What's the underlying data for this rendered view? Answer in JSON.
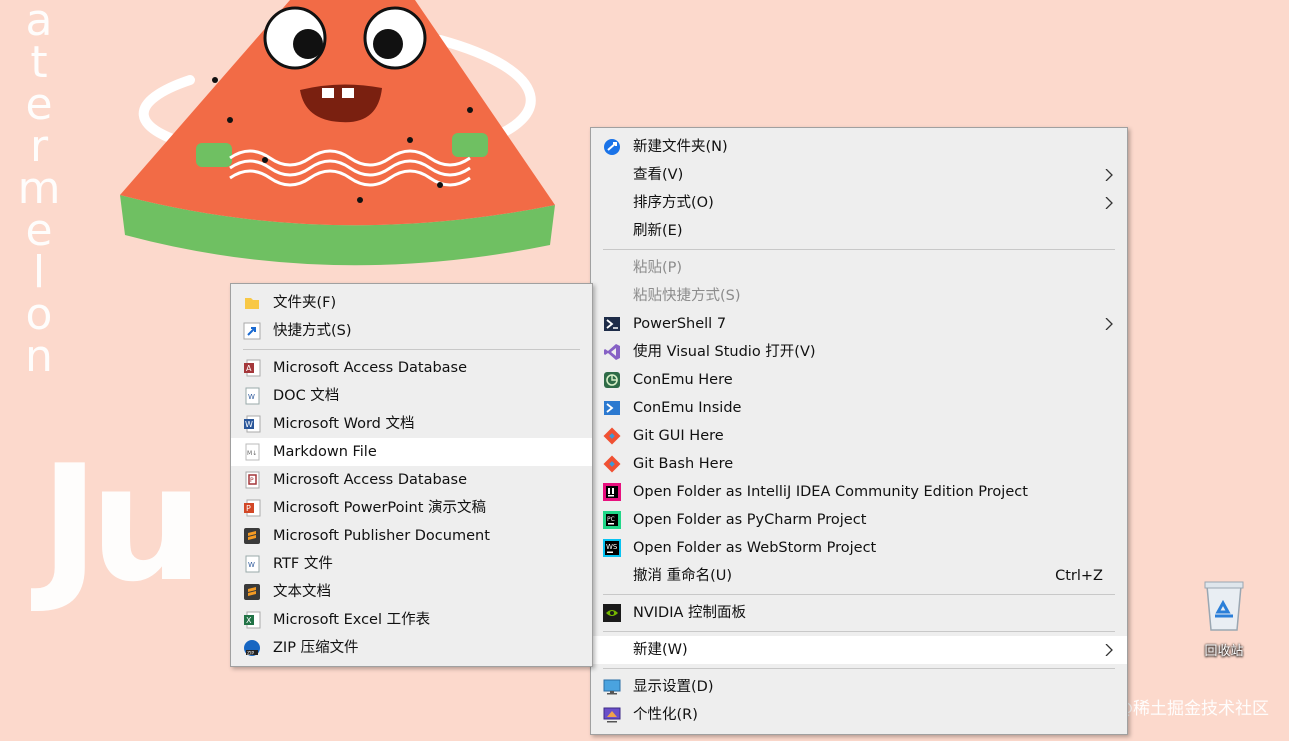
{
  "wallpaper": {
    "side_text": [
      "a",
      "t",
      "e",
      "r",
      "m",
      "e",
      "l",
      "o",
      "n"
    ],
    "big_text": "Ju",
    "watermark": "@稀土掘金技术社区"
  },
  "desktop": {
    "recycle_bin_label": "回收站"
  },
  "context_menu": {
    "items": [
      {
        "label": "新建文件夹(N)",
        "icon": "new-folder-icon"
      },
      {
        "label": "查看(V)",
        "submenu": true
      },
      {
        "label": "排序方式(O)",
        "submenu": true
      },
      {
        "label": "刷新(E)"
      },
      {
        "label": "粘贴(P)",
        "disabled": true
      },
      {
        "label": "粘贴快捷方式(S)",
        "disabled": true
      },
      {
        "label": "PowerShell 7",
        "icon": "powershell-icon",
        "submenu": true
      },
      {
        "label": "使用 Visual Studio 打开(V)",
        "icon": "visual-studio-icon"
      },
      {
        "label": "ConEmu Here",
        "icon": "conemu-icon"
      },
      {
        "label": "ConEmu Inside",
        "icon": "conemu-inside-icon"
      },
      {
        "label": "Git GUI Here",
        "icon": "git-icon"
      },
      {
        "label": "Git Bash Here",
        "icon": "git-icon"
      },
      {
        "label": "Open Folder as IntelliJ IDEA Community Edition Project",
        "icon": "intellij-icon"
      },
      {
        "label": "Open Folder as PyCharm Project",
        "icon": "pycharm-icon"
      },
      {
        "label": "Open Folder as WebStorm Project",
        "icon": "webstorm-icon"
      },
      {
        "label": "撤消 重命名(U)",
        "shortcut": "Ctrl+Z"
      },
      {
        "label": "NVIDIA 控制面板",
        "icon": "nvidia-icon"
      },
      {
        "label": "新建(W)",
        "submenu": true,
        "highlighted": true
      },
      {
        "label": "显示设置(D)",
        "icon": "display-icon"
      },
      {
        "label": "个性化(R)",
        "icon": "personalize-icon"
      }
    ]
  },
  "new_submenu": {
    "items": [
      {
        "label": "文件夹(F)",
        "icon": "folder-icon"
      },
      {
        "label": "快捷方式(S)",
        "icon": "shortcut-icon"
      },
      {
        "label": "Microsoft Access Database",
        "icon": "access-icon"
      },
      {
        "label": "DOC 文档",
        "icon": "doc-icon"
      },
      {
        "label": "Microsoft Word 文档",
        "icon": "word-icon"
      },
      {
        "label": "Markdown File",
        "icon": "markdown-icon",
        "highlighted": true
      },
      {
        "label": "Microsoft Access Database",
        "icon": "access-icon"
      },
      {
        "label": "Microsoft PowerPoint 演示文稿",
        "icon": "powerpoint-icon"
      },
      {
        "label": "Microsoft Publisher Document",
        "icon": "sublime-icon"
      },
      {
        "label": "RTF 文件",
        "icon": "rtf-icon"
      },
      {
        "label": "文本文档",
        "icon": "sublime-icon"
      },
      {
        "label": "Microsoft Excel 工作表",
        "icon": "excel-icon"
      },
      {
        "label": "ZIP 压缩文件",
        "icon": "zip-icon"
      }
    ]
  },
  "colors": {
    "wallpaper_bg": "#fcd9cc",
    "menu_bg": "#eeeeee",
    "highlight_bg": "#ffffff",
    "disabled_text": "#8c8c8c"
  }
}
